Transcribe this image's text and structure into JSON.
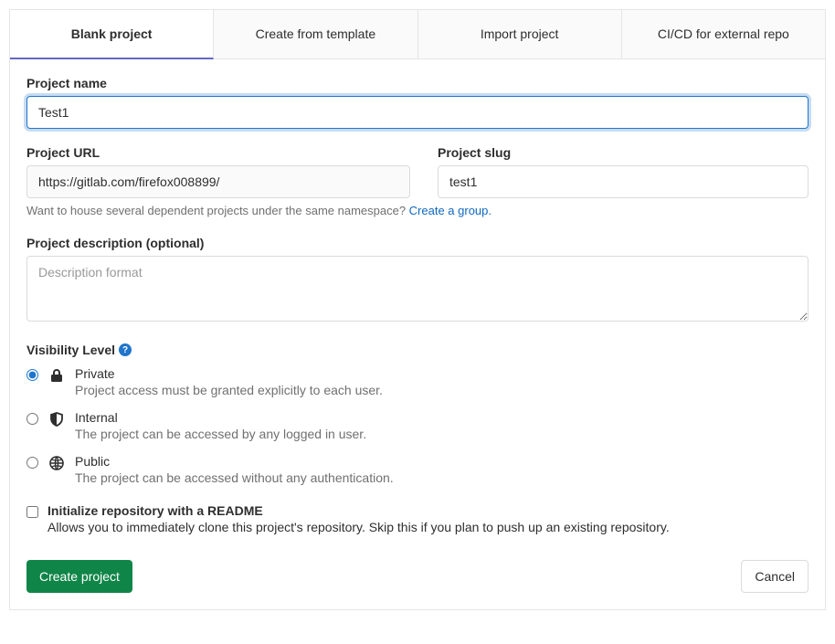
{
  "tabs": {
    "blank": "Blank project",
    "template": "Create from template",
    "import": "Import project",
    "cicd": "CI/CD for external repo"
  },
  "form": {
    "project_name_label": "Project name",
    "project_name_value": "Test1",
    "project_url_label": "Project URL",
    "project_url_value": "https://gitlab.com/firefox008899/",
    "project_slug_label": "Project slug",
    "project_slug_value": "test1",
    "namespace_hint": "Want to house several dependent projects under the same namespace? ",
    "namespace_link": "Create a group.",
    "description_label": "Project description (optional)",
    "description_placeholder": "Description format",
    "visibility_label": "Visibility Level",
    "visibility": {
      "private": {
        "title": "Private",
        "desc": "Project access must be granted explicitly to each user."
      },
      "internal": {
        "title": "Internal",
        "desc": "The project can be accessed by any logged in user."
      },
      "public": {
        "title": "Public",
        "desc": "The project can be accessed without any authentication."
      }
    },
    "readme": {
      "title": "Initialize repository with a README",
      "desc": "Allows you to immediately clone this project's repository. Skip this if you plan to push up an existing repository."
    },
    "create_button": "Create project",
    "cancel_button": "Cancel"
  }
}
